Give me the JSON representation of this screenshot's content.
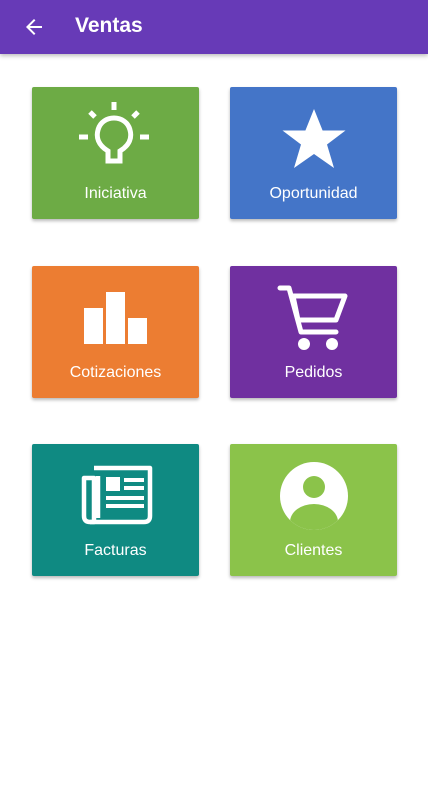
{
  "appbar": {
    "title": "Ventas",
    "back_icon": "arrow-left-icon",
    "color": "#673AB7"
  },
  "tiles": [
    {
      "label": "Iniciativa",
      "icon": "lightbulb-icon",
      "color": "#6DAB45"
    },
    {
      "label": "Oportunidad",
      "icon": "star-icon",
      "color": "#4475C8"
    },
    {
      "label": "Cotizaciones",
      "icon": "bar-chart-icon",
      "color": "#EC7D32"
    },
    {
      "label": "Pedidos",
      "icon": "shopping-cart-icon",
      "color": "#7030A0"
    },
    {
      "label": "Facturas",
      "icon": "newspaper-icon",
      "color": "#0F8A82"
    },
    {
      "label": "Clientes",
      "icon": "user-circle-icon",
      "color": "#8BC34A"
    }
  ]
}
